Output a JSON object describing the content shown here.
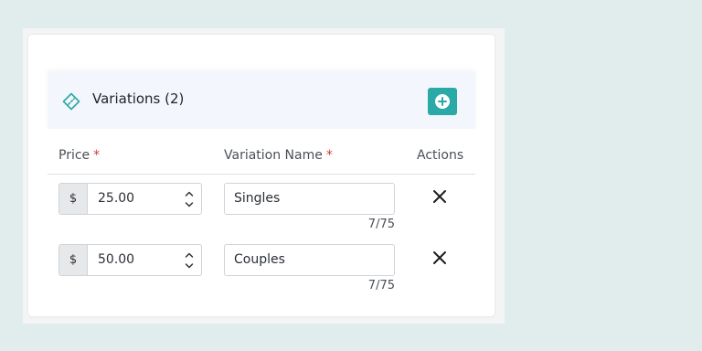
{
  "section": {
    "title": "Variations (2)",
    "icon": "ticket-icon",
    "add_icon": "plus-circle-icon",
    "accent_color": "#2aa9a6"
  },
  "columns": {
    "price": "Price",
    "variation_name": "Variation Name",
    "actions": "Actions",
    "required_marker": "*"
  },
  "rows": [
    {
      "currency": "$",
      "price": "25.00",
      "name": "Singles",
      "counter": "7/75"
    },
    {
      "currency": "$",
      "price": "50.00",
      "name": "Couples",
      "counter": "7/75"
    }
  ]
}
